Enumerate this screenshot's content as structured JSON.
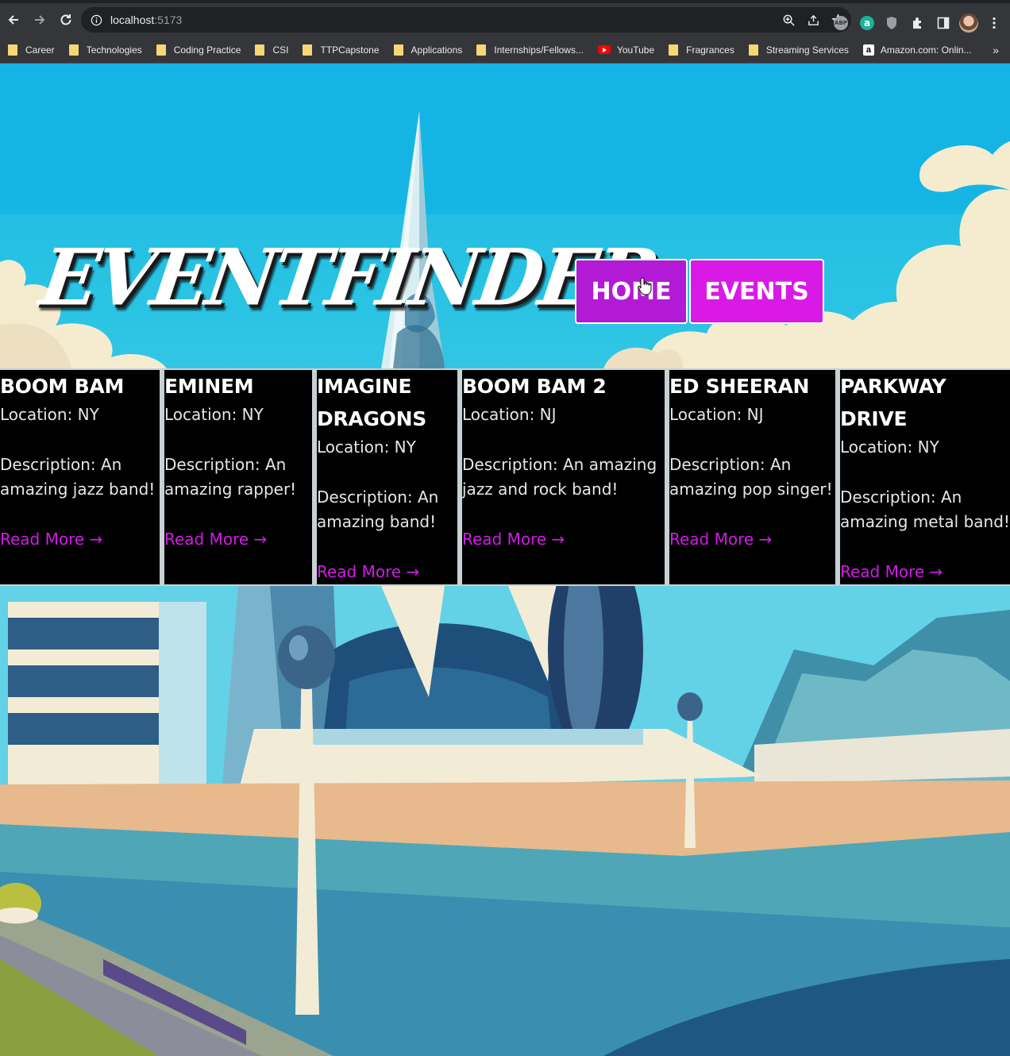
{
  "browser": {
    "url_host": "localhost",
    "url_port": ":5173",
    "bookmarks": [
      {
        "label": "Career",
        "icon": "folder-icon"
      },
      {
        "label": "Technologies",
        "icon": "folder-icon"
      },
      {
        "label": "Coding Practice",
        "icon": "folder-icon"
      },
      {
        "label": "CSI",
        "icon": "folder-icon"
      },
      {
        "label": "TTPCapstone",
        "icon": "folder-icon"
      },
      {
        "label": "Applications",
        "icon": "folder-icon"
      },
      {
        "label": "Internships/Fellows...",
        "icon": "folder-icon"
      },
      {
        "label": "YouTube",
        "icon": "youtube-icon"
      },
      {
        "label": "Fragrances",
        "icon": "folder-icon"
      },
      {
        "label": "Streaming Services",
        "icon": "folder-icon"
      },
      {
        "label": "Amazon.com: Onlin...",
        "icon": "amazon-icon"
      }
    ],
    "more_label": "»"
  },
  "header": {
    "logo": "EVENTFINDER",
    "nav": {
      "home": "HOME",
      "events": "EVENTS"
    }
  },
  "events": [
    {
      "name": "BOOM BAM",
      "location": "Location: NY",
      "description": "Description: An amazing jazz band!",
      "link": "Read More →"
    },
    {
      "name": "EMINEM",
      "location": "Location: NY",
      "description": "Description: An amazing rapper!",
      "link": "Read More →"
    },
    {
      "name": "IMAGINE DRAGONS",
      "location": "Location: NY",
      "description": "Description: An amazing band!",
      "link": "Read More →"
    },
    {
      "name": "BOOM BAM 2",
      "location": "Location: NJ",
      "description": "Description: An amazing jazz and rock band!",
      "link": "Read More →"
    },
    {
      "name": "ED SHEERAN",
      "location": "Location: NJ",
      "description": "Description: An amazing pop singer!",
      "link": "Read More →"
    },
    {
      "name": "PARKWAY DRIVE",
      "location": "Location: NY",
      "description": "Description: An amazing metal band!",
      "link": "Read More →"
    }
  ],
  "colors": {
    "accent": "#d21be6",
    "home_button": "#b21ad6",
    "events_button": "#d91ae6",
    "sky": "#14b5e4"
  }
}
